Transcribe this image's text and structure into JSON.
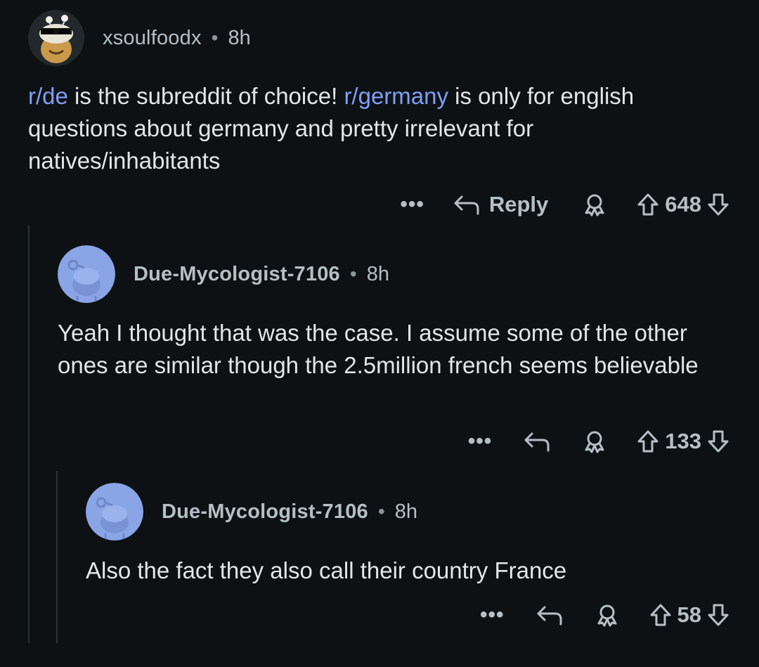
{
  "comments": [
    {
      "username": "xsoulfoodx",
      "separator": "•",
      "time": "8h",
      "body": {
        "link1": "r/de",
        "text1": " is the subreddit of choice! ",
        "link2": "r/germany",
        "text2": " is only for english questions about germany and pretty irrelevant for natives/inhabitants"
      },
      "more": "•••",
      "reply_label": "Reply",
      "score": "648"
    },
    {
      "username": "Due-Mycologist-7106",
      "separator": "•",
      "time": "8h",
      "body_text": "Yeah I thought that was the case. I assume some of the other ones are similar though the 2.5million french seems believable",
      "more": "•••",
      "score": "133"
    },
    {
      "username": "Due-Mycologist-7106",
      "separator": "•",
      "time": "8h",
      "body_text": "Also the fact they also call their country France",
      "more": "•••",
      "score": "58"
    }
  ],
  "colors": {
    "background": "#0e1113",
    "link": "#7f9ff7",
    "snoo_avatar": "#8aa5e6"
  },
  "icons": [
    "reply-arrow-icon",
    "award-icon",
    "upvote-icon",
    "downvote-icon",
    "more-options-icon"
  ]
}
